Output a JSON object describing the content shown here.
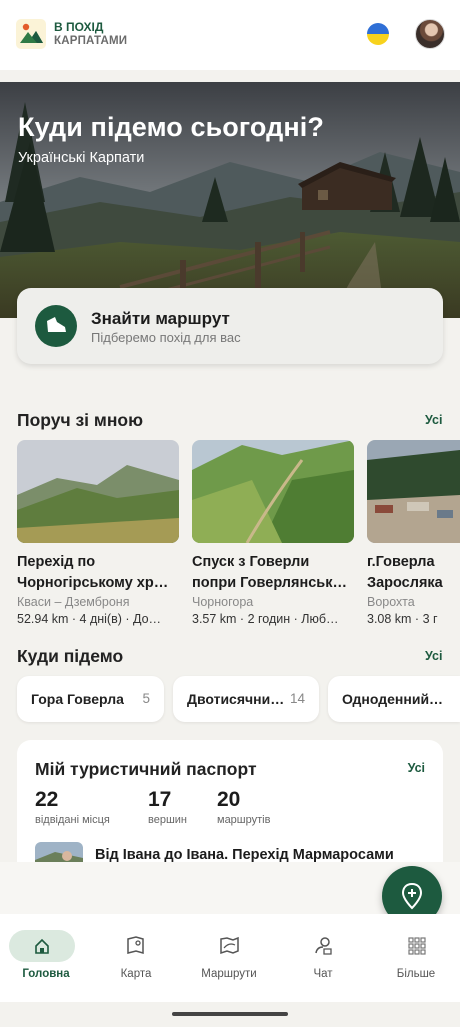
{
  "header": {
    "brand_line1": "В ПОХІД",
    "brand_line2": "КАРПАТАМИ"
  },
  "hero": {
    "title": "Куди підемо сьогодні?",
    "subtitle": "Українські Карпати"
  },
  "find_route": {
    "title": "Знайти маршрут",
    "subtitle": "Підберемо похід для вас"
  },
  "nearby": {
    "title": "Поруч зі мною",
    "see_all": "Усі",
    "items": [
      {
        "name": "Перехід по Чорногірському хр…",
        "name_line1": "Перехід по",
        "name_line2": "Чорногірському хр…",
        "location": "Кваси – Дземброня",
        "meta": "52.94 km · 4 дні(в) · До…"
      },
      {
        "name": "Спуск з Говерли попри Говерлянськ…",
        "name_line1": "Спуск з Говерли",
        "name_line2": "попри Говерлянськ…",
        "location": "Чорногора",
        "meta": "3.57 km · 2 годин · Люб…"
      },
      {
        "name": "г.Говерла Заросляка",
        "name_line1": "г.Говерла",
        "name_line2": "Заросляка",
        "location": "Ворохта",
        "meta": "3.08 km · 3 г"
      }
    ]
  },
  "where_to_go": {
    "title": "Куди підемо",
    "see_all": "Усі",
    "chips": [
      {
        "label": "Гора Говерла",
        "count": "5"
      },
      {
        "label": "Двотисячни…",
        "count": "14"
      },
      {
        "label": "Одноденний…",
        "count": ""
      }
    ]
  },
  "passport": {
    "title": "Мій туристичний паспорт",
    "see_all": "Усі",
    "stats": [
      {
        "value": "22",
        "label": "відвідані місця"
      },
      {
        "value": "17",
        "label": "вершин"
      },
      {
        "value": "20",
        "label": "маршрутів"
      }
    ],
    "trip_name": "Від Івана до Івана. Перехід Мармаросами"
  },
  "nav": {
    "items": [
      {
        "label": "Головна",
        "icon": "home-icon",
        "active": true
      },
      {
        "label": "Карта",
        "icon": "map-icon",
        "active": false
      },
      {
        "label": "Маршрути",
        "icon": "routes-icon",
        "active": false
      },
      {
        "label": "Чат",
        "icon": "chat-icon",
        "active": false
      },
      {
        "label": "Більше",
        "icon": "grid-icon",
        "active": false
      }
    ]
  },
  "colors": {
    "brand_green": "#1d5a3f",
    "background": "#f3f2ee"
  }
}
